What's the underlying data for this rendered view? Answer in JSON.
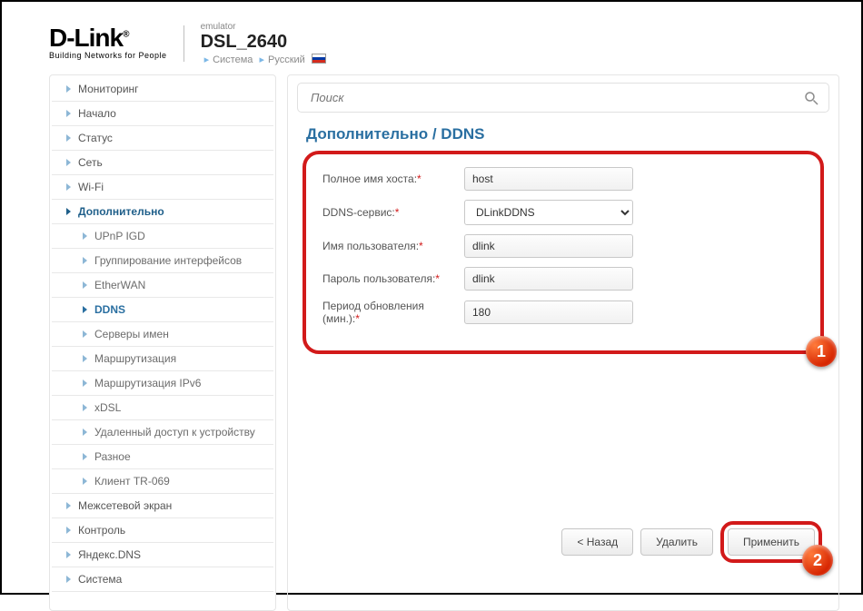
{
  "header": {
    "brand_main": "D-Link",
    "brand_tag": "Building Networks for People",
    "emulator": "emulator",
    "device": "DSL_2640",
    "crumb_system": "Система",
    "crumb_lang": "Русский"
  },
  "sidebar": {
    "items": [
      {
        "label": "Мониторинг"
      },
      {
        "label": "Начало"
      },
      {
        "label": "Статус"
      },
      {
        "label": "Сеть"
      },
      {
        "label": "Wi-Fi"
      },
      {
        "label": "Дополнительно",
        "active": true
      },
      {
        "label": "Межсетевой экран"
      },
      {
        "label": "Контроль"
      },
      {
        "label": "Яндекс.DNS"
      },
      {
        "label": "Система"
      }
    ],
    "subitems": [
      {
        "label": "UPnP IGD"
      },
      {
        "label": "Группирование интерфейсов"
      },
      {
        "label": "EtherWAN"
      },
      {
        "label": "DDNS",
        "active": true
      },
      {
        "label": "Серверы имен"
      },
      {
        "label": "Маршрутизация"
      },
      {
        "label": "Маршрутизация IPv6"
      },
      {
        "label": "xDSL"
      },
      {
        "label": "Удаленный доступ к устройству"
      },
      {
        "label": "Разное"
      },
      {
        "label": "Клиент TR-069"
      }
    ]
  },
  "search": {
    "placeholder": "Поиск"
  },
  "page_title": "Дополнительно /  DDNS",
  "form": {
    "hostname_label": "Полное имя хоста:",
    "hostname_value": "host",
    "service_label": "DDNS-сервис:",
    "service_value": "DLinkDDNS",
    "user_label": "Имя пользователя:",
    "user_value": "dlink",
    "password_label": "Пароль пользователя:",
    "password_value": "dlink",
    "period_label": "Период обновления (мин.):",
    "period_value": "180"
  },
  "buttons": {
    "back": "< Назад",
    "delete": "Удалить",
    "apply": "Применить"
  },
  "badges": {
    "one": "1",
    "two": "2"
  }
}
